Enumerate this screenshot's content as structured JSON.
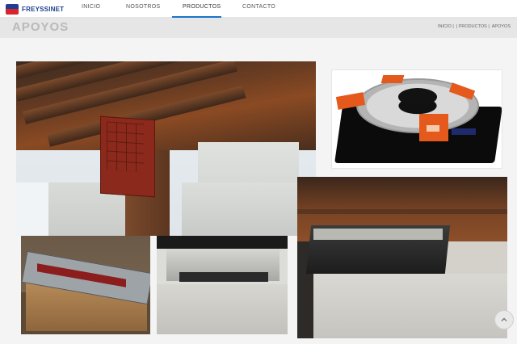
{
  "brand": {
    "name": "FREYSSINET"
  },
  "nav": {
    "items": [
      {
        "label": "INICIO"
      },
      {
        "label": "NOSOTROS"
      },
      {
        "label": "PRODUCTOS"
      },
      {
        "label": "CONTACTO"
      }
    ],
    "active": "PRODUCTOS"
  },
  "page": {
    "title": "APOYOS",
    "breadcrumb": [
      "INICIO |",
      "| PRODUCTOS |",
      "APOYOS"
    ]
  },
  "colors": {
    "accent": "#1a74c9",
    "brand_blue": "#1e3f8f",
    "brand_red": "#d9232d"
  },
  "icons": {
    "scroll_top": "chevron-up-icon"
  }
}
